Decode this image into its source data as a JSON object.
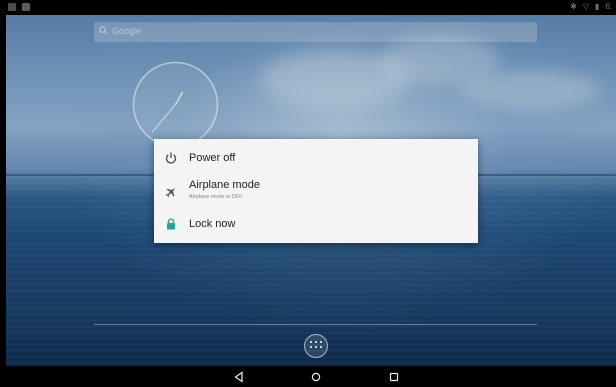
{
  "status_bar": {
    "left_icons": [
      "app-notification-icon",
      "screenshot-notification-icon"
    ],
    "right_icons": [
      "bluetooth-icon",
      "wifi-icon",
      "battery-icon"
    ],
    "time": "6:"
  },
  "search": {
    "label": "Google",
    "icon": "search-icon"
  },
  "clock": {
    "hour_hand_angle": 30,
    "minute_hand_angle": 220
  },
  "power_menu": {
    "items": [
      {
        "label": "Power off",
        "icon": "power-icon"
      },
      {
        "label": "Airplane mode",
        "sublabel": "Airplane mode is OFF",
        "icon": "airplane-icon"
      },
      {
        "label": "Lock now",
        "icon": "lock-icon"
      }
    ],
    "accent": "#26a69a"
  },
  "dock": {
    "all_apps_icon": "all-apps-icon"
  },
  "nav_bar": {
    "back": "back-icon",
    "home": "home-icon",
    "recents": "recents-icon"
  }
}
